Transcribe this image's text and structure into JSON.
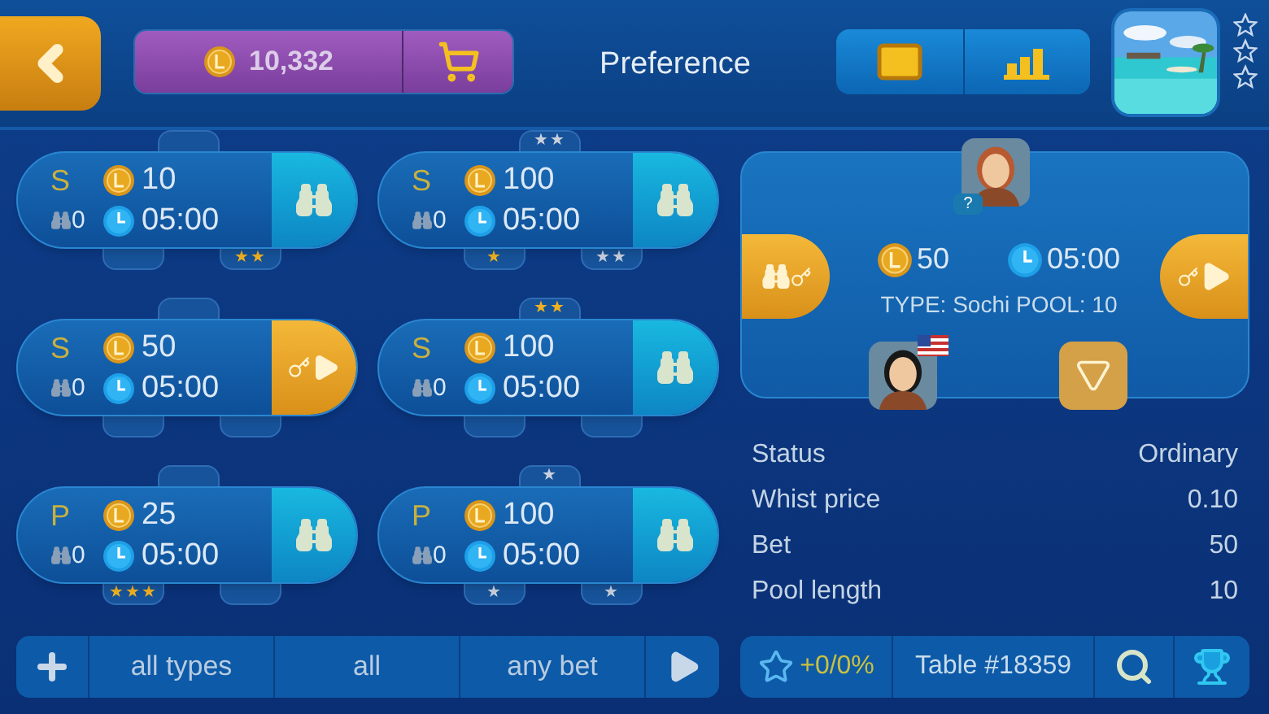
{
  "top_bar": {
    "balance": "10,332",
    "title": "Preference"
  },
  "tables": [
    {
      "type": "S",
      "bet": "10",
      "spectators": "0",
      "time": "05:00",
      "kind": "watch",
      "seats": [
        {
          "kind": "empty"
        },
        {
          "kind": "empty"
        },
        {
          "kind": "player",
          "rank": "★★",
          "color": "#f0b020"
        }
      ]
    },
    {
      "type": "S",
      "bet": "100",
      "spectators": "0",
      "time": "05:00",
      "kind": "watch",
      "seats": [
        {
          "kind": "player",
          "rank": "★★",
          "color": "#c8d0dc"
        },
        {
          "kind": "player",
          "rank": "★",
          "color": "#f0b020"
        },
        {
          "kind": "player",
          "rank": "★★",
          "color": "#c8d0dc"
        }
      ]
    },
    {
      "type": "S",
      "bet": "50",
      "spectators": "0",
      "time": "05:00",
      "kind": "join",
      "seats": [
        {
          "kind": "empty"
        },
        {
          "kind": "empty"
        },
        {
          "kind": "empty"
        }
      ]
    },
    {
      "type": "S",
      "bet": "100",
      "spectators": "0",
      "time": "05:00",
      "kind": "watch",
      "seats": [
        {
          "kind": "player",
          "rank": "★★",
          "color": "#f0b020"
        },
        {
          "kind": "empty"
        },
        {
          "kind": "empty"
        }
      ]
    },
    {
      "type": "P",
      "bet": "25",
      "spectators": "0",
      "time": "05:00",
      "kind": "watch",
      "seats": [
        {
          "kind": "empty"
        },
        {
          "kind": "player",
          "rank": "★★★",
          "color": "#f0b020"
        },
        {
          "kind": "empty"
        }
      ]
    },
    {
      "type": "P",
      "bet": "100",
      "spectators": "0",
      "time": "05:00",
      "kind": "watch",
      "seats": [
        {
          "kind": "player",
          "rank": "★",
          "color": "#c8d0dc"
        },
        {
          "kind": "player",
          "rank": "★",
          "color": "#c8d0dc"
        },
        {
          "kind": "player",
          "rank": "★",
          "color": "#c8d0dc"
        }
      ]
    }
  ],
  "filters": [
    "all types",
    "all",
    "any bet"
  ],
  "selected_table": {
    "bet": "50",
    "time": "05:00",
    "info": "TYPE: Sochi POOL: 10",
    "players": [
      {
        "badge": "?",
        "flag": false
      },
      {
        "flag": true
      }
    ]
  },
  "details": [
    {
      "label": "Status",
      "value": "Ordinary"
    },
    {
      "label": "Whist price",
      "value": "0.10"
    },
    {
      "label": "Bet",
      "value": "50"
    },
    {
      "label": "Pool length",
      "value": "10"
    }
  ],
  "table_bar": {
    "rating": "+0/0%",
    "table": "Table #18359"
  }
}
